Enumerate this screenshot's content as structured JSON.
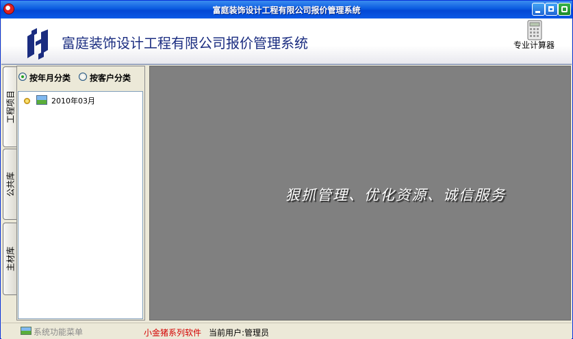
{
  "window": {
    "title": "富庭装饰设计工程有限公司报价管理系统"
  },
  "header": {
    "company_name": "富庭装饰设计工程有限公司报价管理系统",
    "calculator_label": "专业计算器"
  },
  "tabs": [
    {
      "label": "工程项目",
      "active": true
    },
    {
      "label": "公共库",
      "active": false
    },
    {
      "label": "主材库",
      "active": false
    }
  ],
  "classify": {
    "by_month": "按年月分类",
    "by_customer": "按客户分类",
    "selected": "by_month"
  },
  "tree": {
    "nodes": [
      {
        "label": "2010年03月"
      }
    ]
  },
  "main": {
    "slogan": "狠抓管理、优化资源、诚信服务"
  },
  "statusbar": {
    "menu_label": "系统功能菜单",
    "software_label": "小金猪系列软件",
    "current_user": "当前用户:管理员"
  },
  "colors": {
    "title_bar": "#0a5be0",
    "company_text": "#1a2c80",
    "workspace_bg": "#808080",
    "software_label": "#d40000"
  }
}
